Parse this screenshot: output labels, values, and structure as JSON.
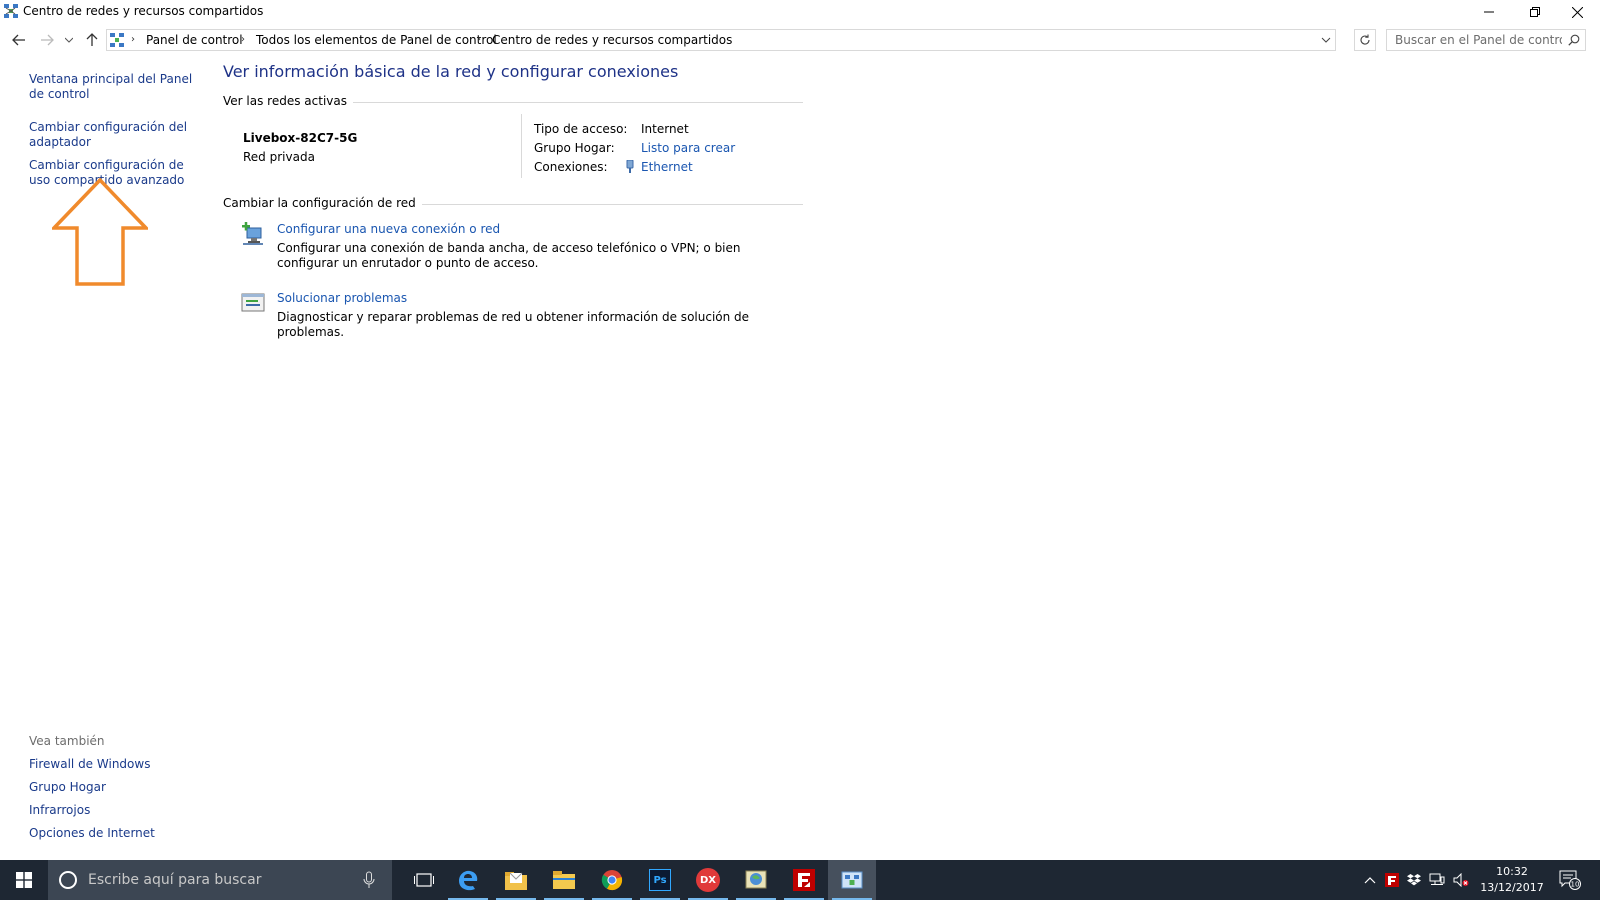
{
  "window": {
    "title": "Centro de redes y recursos compartidos"
  },
  "address": {
    "breadcrumbs": [
      "Panel de control",
      "Todos los elementos de Panel de control",
      "Centro de redes y recursos compartidos"
    ],
    "search_placeholder": "Buscar en el Panel de control"
  },
  "sidebar": {
    "links": [
      "Ventana principal del Panel de control",
      "Cambiar configuración del adaptador",
      "Cambiar configuración de uso compartido avanzado"
    ],
    "see_also_title": "Vea también",
    "see_also": [
      "Firewall de Windows",
      "Grupo Hogar",
      "Infrarrojos",
      "Opciones de Internet"
    ]
  },
  "main": {
    "title": "Ver información básica de la red y configurar conexiones",
    "active_networks_title": "Ver las redes activas",
    "network": {
      "name": "Livebox-82C7-5G",
      "type": "Red privada",
      "access_label": "Tipo de acceso:",
      "access_value": "Internet",
      "homegroup_label": "Grupo Hogar:",
      "homegroup_value": "Listo para crear",
      "connections_label": "Conexiones:",
      "connections_value": "Ethernet"
    },
    "change_settings_title": "Cambiar la configuración de red",
    "tasks": [
      {
        "link": "Configurar una nueva conexión o red",
        "description": "Configurar una conexión de banda ancha, de acceso telefónico o VPN; o bien configurar un enrutador o punto de acceso.",
        "icon": "new-connection-icon"
      },
      {
        "link": "Solucionar problemas",
        "description": "Diagnosticar y reparar problemas de red u obtener información de solución de problemas.",
        "icon": "troubleshoot-icon"
      }
    ]
  },
  "taskbar": {
    "search_placeholder": "Escribe aquí para buscar",
    "apps": [
      "edge-icon",
      "mail-folder-icon",
      "file-explorer-icon",
      "chrome-icon",
      "photoshop-icon",
      "dx-icon",
      "network-app-icon",
      "filezilla-icon",
      "control-panel-icon"
    ],
    "photoshop_label": "Ps",
    "dx_label": "DX",
    "time": "10:32",
    "date": "13/12/2017",
    "notification_count": "10"
  },
  "colors": {
    "link": "#1a56b0",
    "title": "#1e3287",
    "taskbar": "#1e2733",
    "arrow": "#f08a2c"
  }
}
